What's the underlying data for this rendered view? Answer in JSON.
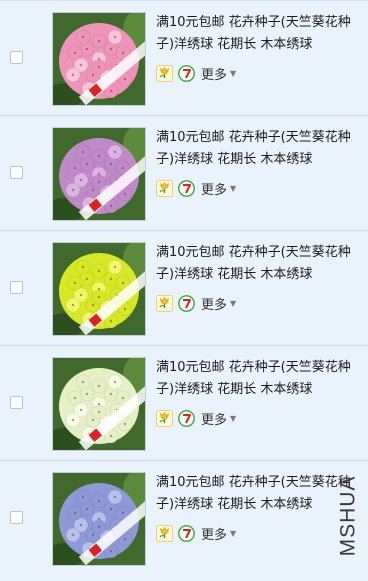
{
  "products": [
    {
      "title": "满10元包邮 花卉种子(天竺葵花种子)洋绣球 花期长 木本绣球",
      "flower_color": "#ef94b8",
      "flower_highlight": "#f8c4d8",
      "more_label": "更多"
    },
    {
      "title": "满10元包邮 花卉种子(天竺葵花种子)洋绣球 花期长 木本绣球",
      "flower_color": "#c08ac8",
      "flower_highlight": "#dcb4e0",
      "more_label": "更多"
    },
    {
      "title": "满10元包邮 花卉种子(天竺葵花种子)洋绣球 花期长 木本绣球",
      "flower_color": "#d8e826",
      "flower_highlight": "#f0f86a",
      "more_label": "更多"
    },
    {
      "title": "满10元包邮 花卉种子(天竺葵花种子)洋绣球 花期长 木本绣球",
      "flower_color": "#e6f0c6",
      "flower_highlight": "#f6fbe6",
      "more_label": "更多"
    },
    {
      "title": "满10元包邮 花卉种子(天竺葵花种子)洋绣球 花期长 木本绣球",
      "flower_color": "#8e9ad8",
      "flower_highlight": "#b8c0ec",
      "more_label": "更多"
    }
  ],
  "badges": [
    "tulip-badge-icon",
    "seven-day-return-badge-icon"
  ],
  "watermark": "MSHUA"
}
